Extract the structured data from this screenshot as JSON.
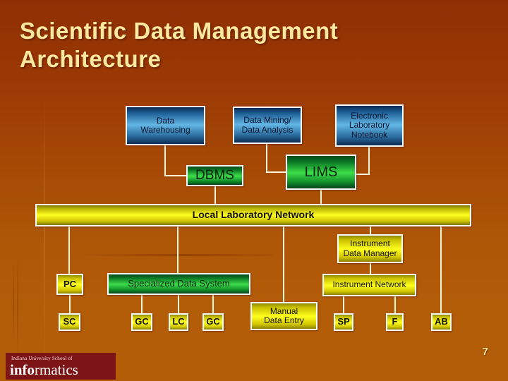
{
  "slide": {
    "title": "Scientific Data\nManagement Architecture",
    "page_number": "7",
    "background_color_top": "#8f2f03",
    "background_color_bottom": "#b35d08",
    "title_color": "#fbe9a0"
  },
  "logo": {
    "line1": "Indiana University School of",
    "line2_bold": "info",
    "line2_rest": "rmatics",
    "background_color": "#7d1416"
  },
  "diagram": {
    "nodes": [
      {
        "id": "data-warehousing",
        "label": "Data\nWarehousing",
        "style": "blue"
      },
      {
        "id": "data-mining",
        "label": "Data Mining/\nData Analysis",
        "style": "blue"
      },
      {
        "id": "electronic-notebook",
        "label": "Electronic\nLaboratory\nNotebook",
        "style": "blue"
      },
      {
        "id": "dbms",
        "label": "DBMS",
        "style": "green"
      },
      {
        "id": "lims",
        "label": "LIMS",
        "style": "green"
      },
      {
        "id": "local-lab-network",
        "label": "Local Laboratory Network",
        "style": "yellow"
      },
      {
        "id": "instrument-data-manager",
        "label": "Instrument\nData Manager",
        "style": "yellow"
      },
      {
        "id": "instrument-network",
        "label": "Instrument Network",
        "style": "yellow"
      },
      {
        "id": "pc",
        "label": "PC",
        "style": "yellow"
      },
      {
        "id": "specialized-data-system",
        "label": "Specialized Data System",
        "style": "green"
      },
      {
        "id": "manual-data-entry",
        "label": "Manual\nData Entry",
        "style": "yellow"
      },
      {
        "id": "sc",
        "label": "SC",
        "style": "yellow"
      },
      {
        "id": "gc-1",
        "label": "GC",
        "style": "yellow"
      },
      {
        "id": "lc",
        "label": "LC",
        "style": "yellow"
      },
      {
        "id": "gc-2",
        "label": "GC",
        "style": "yellow"
      },
      {
        "id": "sp",
        "label": "SP",
        "style": "yellow"
      },
      {
        "id": "f",
        "label": "F",
        "style": "yellow"
      },
      {
        "id": "ab",
        "label": "AB",
        "style": "yellow"
      }
    ],
    "colors": {
      "blue_box": "#63b6e4",
      "green_box": "#3ddd4a",
      "yellow_box": "#ffff1e",
      "connector": "#fff6d8",
      "box_border": "#ffffff"
    }
  }
}
